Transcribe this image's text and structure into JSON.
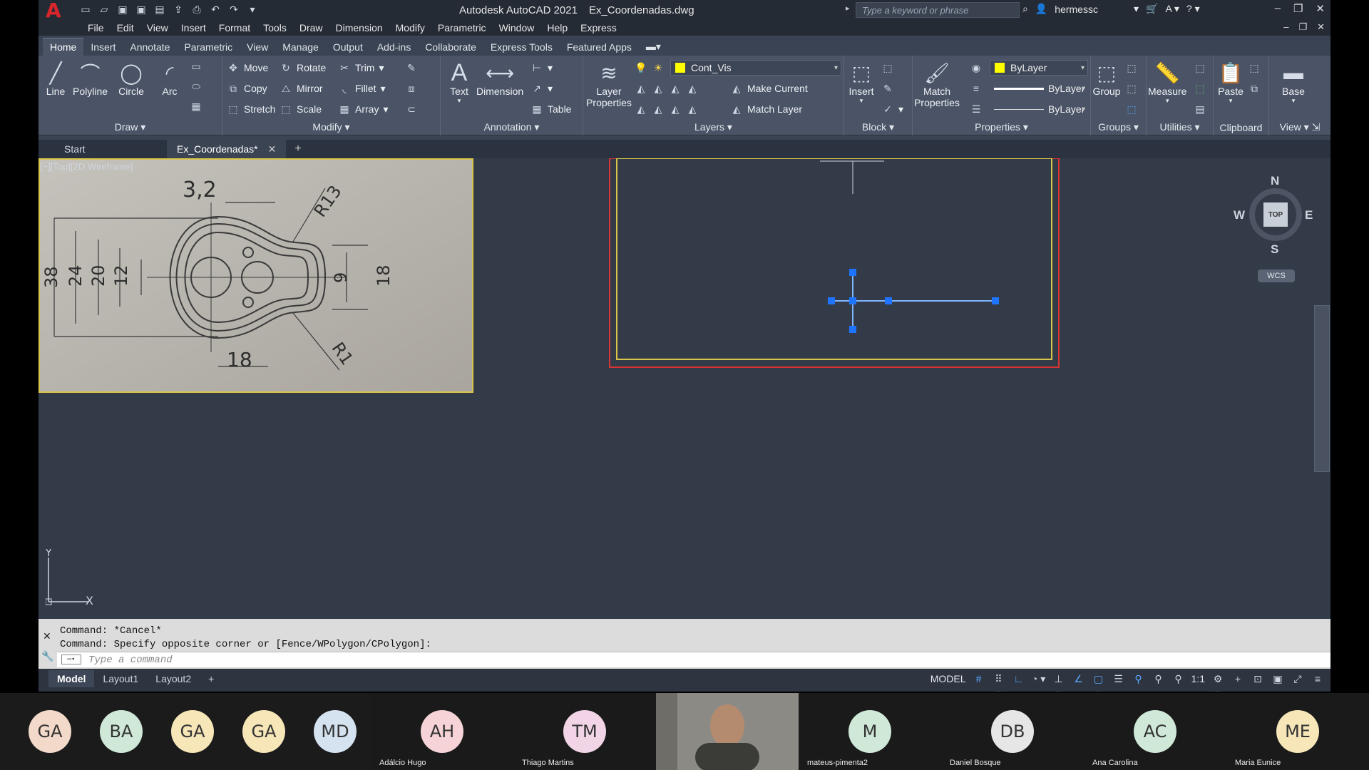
{
  "app": {
    "title": "Autodesk AutoCAD 2021",
    "filename": "Ex_Coordenadas.dwg",
    "search_placeholder": "Type a keyword or phrase",
    "user": "hermessc"
  },
  "menu": [
    "File",
    "Edit",
    "View",
    "Insert",
    "Format",
    "Tools",
    "Draw",
    "Dimension",
    "Modify",
    "Parametric",
    "Window",
    "Help",
    "Express"
  ],
  "ribbon_tabs": [
    "Home",
    "Insert",
    "Annotate",
    "Parametric",
    "View",
    "Manage",
    "Output",
    "Add-ins",
    "Collaborate",
    "Express Tools",
    "Featured Apps"
  ],
  "ribbon": {
    "draw": {
      "title": "Draw",
      "line": "Line",
      "polyline": "Polyline",
      "circle": "Circle",
      "arc": "Arc"
    },
    "modify": {
      "title": "Modify",
      "move": "Move",
      "rotate": "Rotate",
      "trim": "Trim",
      "copy": "Copy",
      "mirror": "Mirror",
      "fillet": "Fillet",
      "stretch": "Stretch",
      "scale": "Scale",
      "array": "Array"
    },
    "annotation": {
      "title": "Annotation",
      "text": "Text",
      "dimension": "Dimension",
      "table": "Table"
    },
    "layers": {
      "title": "Layers",
      "layer_properties": "Layer Properties",
      "current_layer": "Cont_Vis",
      "make_current": "Make Current",
      "match_layer": "Match Layer"
    },
    "block": {
      "title": "Block",
      "insert": "Insert"
    },
    "properties": {
      "title": "Properties",
      "match_properties": "Match Properties",
      "color": "ByLayer",
      "lineweight": "ByLayer",
      "linetype": "ByLayer"
    },
    "groups": {
      "title": "Groups",
      "group": "Group"
    },
    "utilities": {
      "title": "Utilities",
      "measure": "Measure"
    },
    "clipboard": {
      "title": "Clipboard",
      "paste": "Paste"
    },
    "view": {
      "title": "View",
      "base": "Base"
    }
  },
  "file_tabs": {
    "start": "Start",
    "active": "Ex_Coordenadas*"
  },
  "viewport_label": "[−][Top][2D Wireframe]",
  "reference_image": {
    "dims": [
      "3,2",
      "R13",
      "38",
      "24",
      "20",
      "12",
      "9",
      "18",
      "18",
      "R1"
    ]
  },
  "viewcube": {
    "n": "N",
    "s": "S",
    "e": "E",
    "w": "W",
    "face": "TOP",
    "wcs": "WCS"
  },
  "ucs": {
    "x": "X",
    "y": "Y"
  },
  "command": {
    "history": [
      "Command: *Cancel*",
      "Command: Specify opposite corner or [Fence/WPolygon/CPolygon]:"
    ],
    "placeholder": "Type a command"
  },
  "layout_tabs": [
    "Model",
    "Layout1",
    "Layout2"
  ],
  "status": {
    "model": "MODEL",
    "scale": "1:1"
  },
  "participants": [
    {
      "initials": "GA",
      "name": "",
      "color": "#f3d9c9"
    },
    {
      "initials": "BA",
      "name": "",
      "color": "#cfe8d8"
    },
    {
      "initials": "GA",
      "name": "",
      "color": "#f6e6b8"
    },
    {
      "initials": "GA",
      "name": "",
      "color": "#f6e6b8"
    },
    {
      "initials": "MD",
      "name": "",
      "color": "#d5e3f1"
    },
    {
      "initials": "AH",
      "name": "Adálcio Hugo",
      "color": "#f6d3d6"
    },
    {
      "initials": "TM",
      "name": "Thiago Martins",
      "color": "#f1d4e6"
    },
    {
      "initials": "M",
      "name": "mateus-pimenta2",
      "color": "#cfe8d8"
    },
    {
      "initials": "DB",
      "name": "Daniel Bosque",
      "color": "#e6e6e6"
    },
    {
      "initials": "AC",
      "name": "Ana Carolina",
      "color": "#cfe8d8"
    },
    {
      "initials": "ME",
      "name": "Maria Eunice",
      "color": "#f6e6b8"
    }
  ]
}
